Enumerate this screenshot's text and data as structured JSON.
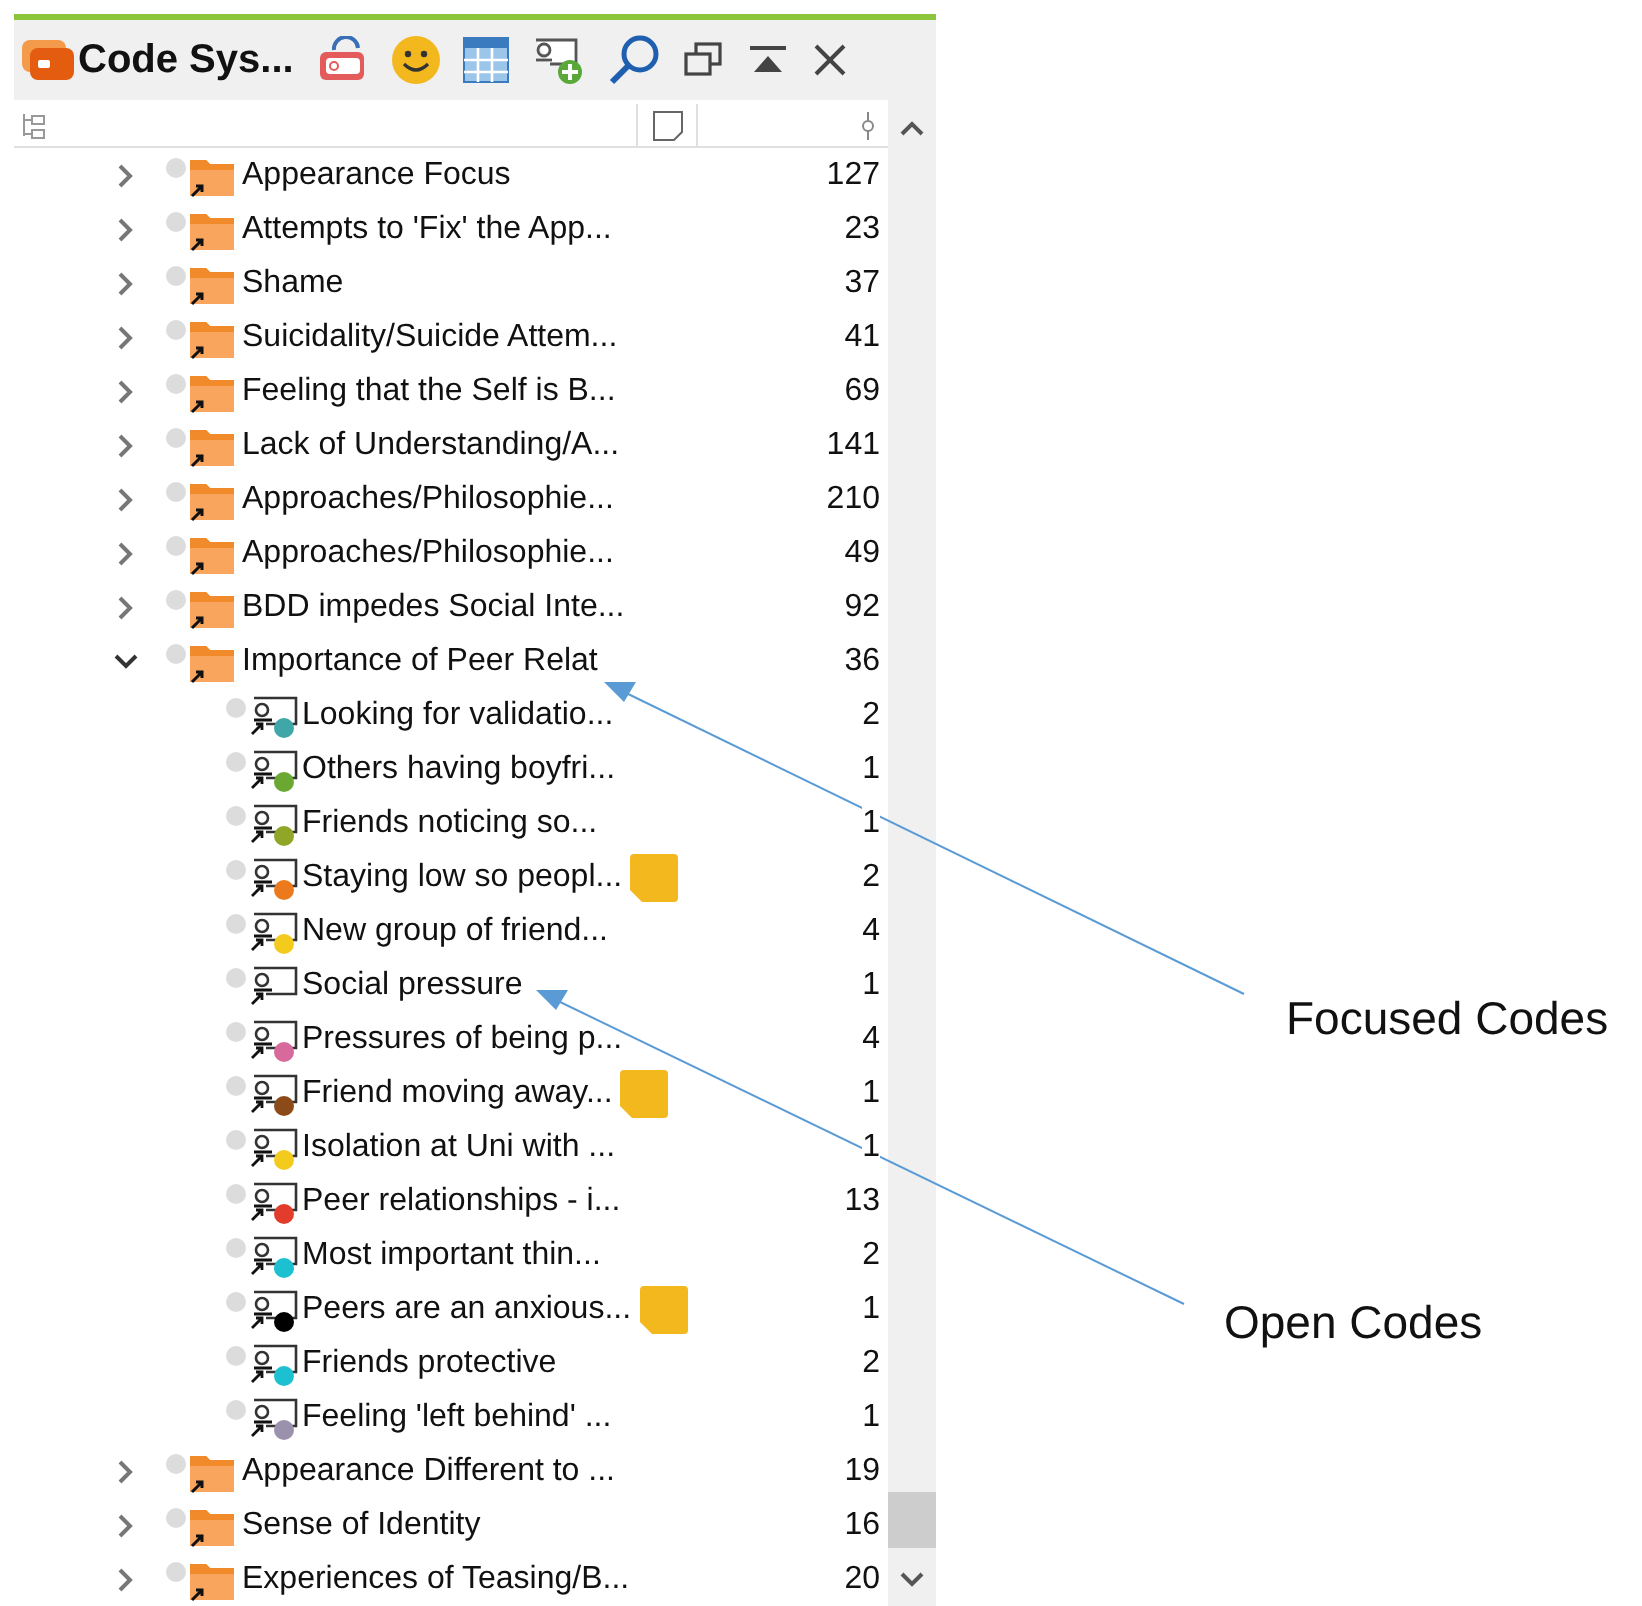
{
  "panel": {
    "title": "Code Sys..."
  },
  "codes": [
    {
      "name": "Appearance Focus",
      "count": "127",
      "expanded": false
    },
    {
      "name": "Attempts to 'Fix' the App...",
      "count": "23",
      "expanded": false
    },
    {
      "name": "Shame",
      "count": "37",
      "expanded": false
    },
    {
      "name": "Suicidality/Suicide Attem...",
      "count": "41",
      "expanded": false
    },
    {
      "name": "Feeling that the Self is B...",
      "count": "69",
      "expanded": false
    },
    {
      "name": "Lack of Understanding/A...",
      "count": "141",
      "expanded": false
    },
    {
      "name": "Approaches/Philosophie...",
      "count": "210",
      "expanded": false
    },
    {
      "name": "Approaches/Philosophie...",
      "count": "49",
      "expanded": false
    },
    {
      "name": "BDD impedes Social Inte...",
      "count": "92",
      "expanded": false
    },
    {
      "name": "Importance of Peer Relat",
      "count": "36",
      "expanded": true,
      "children": [
        {
          "name": "Looking for validatio...",
          "count": "2",
          "color": "#3fa7a8",
          "memo": false
        },
        {
          "name": "Others having boyfri...",
          "count": "1",
          "color": "#6aa832",
          "memo": false
        },
        {
          "name": "Friends noticing so...",
          "count": "1",
          "color": "#8fa626",
          "memo": false
        },
        {
          "name": "Staying low so peopl...",
          "count": "2",
          "color": "#ec7a1c",
          "memo": true
        },
        {
          "name": "New group of friend...",
          "count": "4",
          "color": "#f2cb1d",
          "memo": false
        },
        {
          "name": "Social pressure",
          "count": "1",
          "memo": false
        },
        {
          "name": "Pressures of being p...",
          "count": "4",
          "color": "#d8699b",
          "memo": false
        },
        {
          "name": "Friend moving away...",
          "count": "1",
          "color": "#8b4a18",
          "memo": true
        },
        {
          "name": "Isolation at Uni with ...",
          "count": "1",
          "color": "#f2cb1d",
          "memo": false
        },
        {
          "name": "Peer relationships - i...",
          "count": "13",
          "color": "#e23c2c",
          "memo": false
        },
        {
          "name": "Most important thin...",
          "count": "2",
          "color": "#1cc0d0",
          "memo": false
        },
        {
          "name": "Peers are an anxious...",
          "count": "1",
          "color": "#000000",
          "memo": true
        },
        {
          "name": "Friends protective",
          "count": "2",
          "color": "#1cc0d0",
          "memo": false
        },
        {
          "name": "Feeling 'left behind' ...",
          "count": "1",
          "color": "#9a91ad",
          "memo": false
        }
      ]
    },
    {
      "name": "Appearance Different to ...",
      "count": "19",
      "expanded": false
    },
    {
      "name": "Sense of Identity",
      "count": "16",
      "expanded": false
    },
    {
      "name": "Experiences of Teasing/B...",
      "count": "20",
      "expanded": false
    }
  ],
  "annotations": [
    {
      "label": "Focused Codes"
    },
    {
      "label": "Open Codes"
    }
  ]
}
